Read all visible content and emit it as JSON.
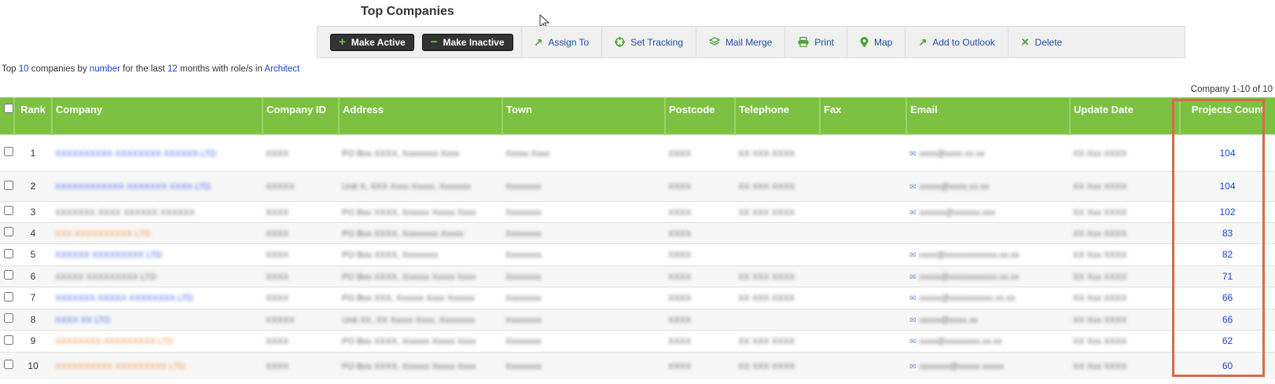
{
  "page": {
    "title": "Top Companies"
  },
  "toolbar": {
    "make_active": "Make Active",
    "make_inactive": "Make Inactive",
    "assign_to": "Assign To",
    "set_tracking": "Set Tracking",
    "mail_merge": "Mail Merge",
    "print": "Print",
    "map": "Map",
    "add_to_outlook": "Add to Outlook",
    "delete": "Delete"
  },
  "summary": {
    "prefix": "Top",
    "top_n": "10",
    "mid1": "companies by",
    "metric": "number",
    "mid2": "for the last",
    "months": "12",
    "mid3": "months with role/s in",
    "role": "Architect"
  },
  "paging": {
    "text": "Company 1-10 of 10"
  },
  "table": {
    "columns": [
      "Rank",
      "Company",
      "Company ID",
      "Address",
      "Town",
      "Postcode",
      "Telephone",
      "Fax",
      "Email",
      "Update Date",
      "Projects Count"
    ],
    "rows": [
      {
        "rank": "1",
        "company": "XXXXXXXXXX XXXXXXXX XXXXXX LTD",
        "company_id": "XXXX",
        "address": "PO Box XXXX, Xxxxxxxx Xxxx",
        "town": "Xxxxx Xxxx",
        "postcode": "XXXX",
        "telephone": "XX XXX XXXX",
        "fax": "",
        "email": "xxxx@xxxx.xx.xx",
        "update_date": "XX Xxx XXXX",
        "count": "104"
      },
      {
        "rank": "2",
        "company": "XXXXXXXXXXXX XXXXXXX XXXX LTD",
        "company_id": "XXXXX",
        "address": "Unit X, XXX Xxxx Xxxxx, Xxxxxxx",
        "town": "Xxxxxxxx",
        "postcode": "XXXX",
        "telephone": "XX XXX XXXX",
        "fax": "",
        "email": "xxxxx@xxxx.xx.xx",
        "update_date": "XX Xxx XXXX",
        "count": "104"
      },
      {
        "rank": "3",
        "company": "XXXXXXX XXXX XXXXXX XXXXXX",
        "company_id": "XXXX",
        "address": "PO Box XXXX, Xxxxxx Xxxxx Xxxx",
        "town": "Xxxxxxxx",
        "postcode": "XXXX",
        "telephone": "XX XXX XXXX",
        "fax": "",
        "email": "xxxxxx@xxxxxx.xxx",
        "update_date": "XX Xxx XXXX",
        "count": "102"
      },
      {
        "rank": "4",
        "company": "XXX XXXXXXXXXX LTD",
        "company_id": "XXXX",
        "address": "PO Box XXXX, Xxxxxxxx Xxxxx",
        "town": "Xxxxxxxx",
        "postcode": "XXXX",
        "telephone": "",
        "fax": "",
        "email": "",
        "update_date": "XX Xxx XXXX",
        "count": "83"
      },
      {
        "rank": "5",
        "company": "XXXXXX XXXXXXXXX LTD",
        "company_id": "XXXX",
        "address": "PO Box XXXX, Xxxxxxxx",
        "town": "Xxxxxxxx",
        "postcode": "XXXX",
        "telephone": "",
        "fax": "",
        "email": "xxxx@xxxxxxxxxxxx.xx.xx",
        "update_date": "XX Xxx XXXX",
        "count": "82"
      },
      {
        "rank": "6",
        "company": "XXXXX XXXXXXXXX LTD",
        "company_id": "XXXX",
        "address": "PO Box XXXX, Xxxxxx Xxxxx Xxxx",
        "town": "Xxxxxxxx",
        "postcode": "XXXX",
        "telephone": "XX XXX XXXX",
        "fax": "",
        "email": "xxxxx@xxxxxxxxxxx.xx.xx",
        "update_date": "XX Xxx XXXX",
        "count": "71"
      },
      {
        "rank": "7",
        "company": "XXXXXXX XXXXX XXXXXXXX LTD",
        "company_id": "XXXX",
        "address": "PO Box XXX, Xxxxxx Xxxx Xxxxxx",
        "town": "Xxxxxxxx",
        "postcode": "XXXX",
        "telephone": "XX XXX XXXX",
        "fax": "",
        "email": "xxxxx@xxxxxxxxxx.xx.xx",
        "update_date": "XX Xxx XXXX",
        "count": "66"
      },
      {
        "rank": "8",
        "company": "XXXX XX LTD",
        "company_id": "XXXXX",
        "address": "Unit XX, XX Xxxxx Xxxx, Xxxxxxxx",
        "town": "Xxxxxxxx",
        "postcode": "XXXX",
        "telephone": "",
        "fax": "",
        "email": "xxxxx@xxxx.xx",
        "update_date": "XX Xxx XXXX",
        "count": "66"
      },
      {
        "rank": "9",
        "company": "XXXXXXXX XXXXXXXXX LTD",
        "company_id": "XXXX",
        "address": "PO Box XXXX, Xxxxxx Xxxxx Xxxx",
        "town": "Xxxxxxxx",
        "postcode": "XXXX",
        "telephone": "XX XXX XXXX",
        "fax": "",
        "email": "xxxx@xxxxxxxx.xx.xx",
        "update_date": "XX Xxx XXXX",
        "count": "62"
      },
      {
        "rank": "10",
        "company": "XXXXXXXXXX XXXXXXXXX LTD",
        "company_id": "XXXX",
        "address": "PO Box XXXX, Xxxxxx Xxxxx Xxxx",
        "town": "Xxxxxxxx",
        "postcode": "XXXX",
        "telephone": "XX XXX XXXX",
        "fax": "",
        "email": "xxxxxxx@xxxxx.xxxxx",
        "update_date": "XX Xxx XXXX",
        "count": "60"
      }
    ]
  },
  "colors": {
    "header_green": "#7cc142",
    "link_blue": "#1a44d8",
    "highlight": "#d9694a"
  }
}
